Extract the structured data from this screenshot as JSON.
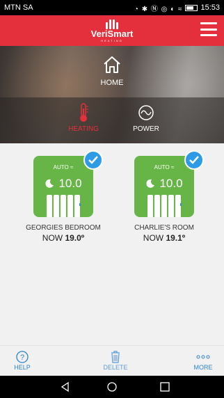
{
  "status_bar": {
    "carrier": "MTN SA",
    "icons": "◔ ✱ Ⓝ ◎ ◐ ≈",
    "time": "15:53"
  },
  "header": {
    "logo_text": "VeriSmart",
    "logo_sub": "HEATING",
    "menu_icon": "hamburger-menu-icon"
  },
  "hero": {
    "home_label": "HOME",
    "modes": [
      {
        "label": "HEATING",
        "icon": "thermometer-icon",
        "active": true
      },
      {
        "label": "POWER",
        "icon": "waveform-icon",
        "active": false
      }
    ]
  },
  "devices": [
    {
      "mode": "AUTO",
      "setpoint": "10.0",
      "name": "GEORGIES BEDROOM",
      "now_label": "NOW",
      "now_value": "19.0º",
      "selected": true
    },
    {
      "mode": "AUTO",
      "setpoint": "10.0",
      "name": "CHARLIE'S ROOM",
      "now_label": "NOW",
      "now_value": "19.1º",
      "selected": true
    }
  ],
  "actions": {
    "help": "HELP",
    "delete": "DELETE",
    "more": "MORE"
  },
  "colors": {
    "brand_red": "#e3303c",
    "tile_green": "#67b546",
    "accent_blue": "#2b84cf"
  }
}
